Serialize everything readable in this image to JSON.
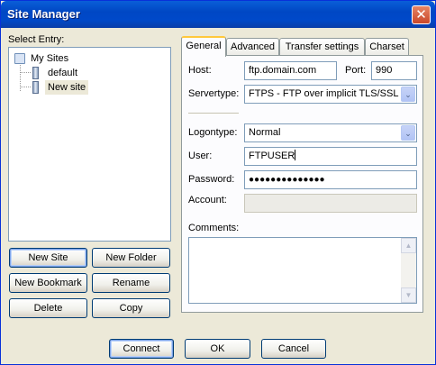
{
  "window": {
    "title": "Site Manager",
    "close_glyph": "✕"
  },
  "left": {
    "select_entry_label": "Select Entry:",
    "tree": {
      "root": "My Sites",
      "children": [
        "default",
        "New site"
      ],
      "selected": "New site"
    },
    "buttons": {
      "new_site": "New Site",
      "new_folder": "New Folder",
      "new_bookmark": "New Bookmark",
      "rename": "Rename",
      "delete": "Delete",
      "copy": "Copy"
    }
  },
  "tabs": {
    "items": [
      "General",
      "Advanced",
      "Transfer settings",
      "Charset"
    ],
    "active": "General"
  },
  "general": {
    "host_label": "Host:",
    "host_value": "ftp.domain.com",
    "port_label": "Port:",
    "port_value": "990",
    "servertype_label": "Servertype:",
    "servertype_value": "FTPS - FTP over implicit TLS/SSL",
    "logontype_label": "Logontype:",
    "logontype_value": "Normal",
    "user_label": "User:",
    "user_value": "FTPUSER",
    "password_label": "Password:",
    "password_value": "●●●●●●●●●●●●●●",
    "account_label": "Account:",
    "account_value": "",
    "comments_label": "Comments:",
    "comments_value": ""
  },
  "footer": {
    "connect": "Connect",
    "ok": "OK",
    "cancel": "Cancel"
  },
  "icons": {
    "dropdown_arrow": "⌄",
    "scroll_up": "▲",
    "scroll_down": "▼"
  },
  "colors": {
    "titlebar": "#0047c4",
    "dialog_bg": "#ece9d8",
    "selection_bg": "#ece9d8",
    "tab_highlight": "#ffc83c"
  }
}
